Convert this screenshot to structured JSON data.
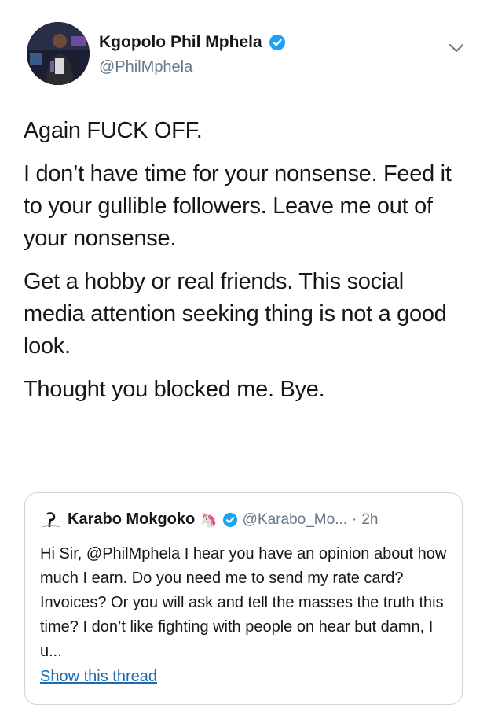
{
  "author": {
    "display_name": "Kgopolo Phil Mphela",
    "handle": "@PhilMphela",
    "verified": true
  },
  "tweet": {
    "paragraphs": [
      "Again FUCK OFF.",
      "I don’t have time for your nonsense. Feed it to your gullible followers. Leave me out of your nonsense.",
      "Get a hobby or real friends. This social media attention seeking thing is not a good look.",
      "Thought you blocked me. Bye."
    ]
  },
  "quoted": {
    "display_name": "Karabo Mokgoko",
    "emoji": "🦄",
    "handle": "@Karabo_Mo...",
    "separator": " · ",
    "time": "2h",
    "text": "Hi Sir, @PhilMphela I hear you have an opinion about how much I earn. Do you need me to send my rate card? Invoices? Or you will ask and tell the masses the truth this time? I don’t like fighting with people on hear but damn, I u...",
    "show_thread": "Show this thread"
  },
  "icons": {
    "verified": "verified-badge-icon",
    "menu": "chevron-down-icon",
    "quoted_logo": "brand-logo-icon"
  },
  "colors": {
    "verified_blue": "#1da1f2",
    "secondary_text": "#657786",
    "link": "#1b6bb4",
    "border": "#ccd6dd"
  }
}
